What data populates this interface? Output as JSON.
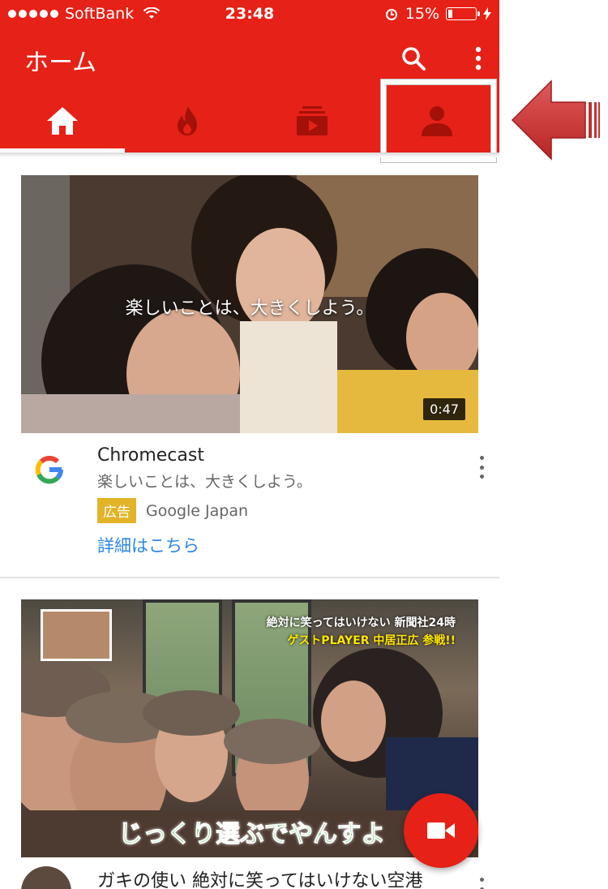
{
  "status_bar": {
    "carrier": "SoftBank",
    "time": "23:48",
    "battery": "15%",
    "battery_level": 0.15
  },
  "app_bar": {
    "title": "ホーム",
    "icons": [
      "search-icon",
      "more-vert-icon"
    ]
  },
  "tabs": [
    {
      "name": "home",
      "icon": "home-icon",
      "selected": true
    },
    {
      "name": "trending",
      "icon": "flame-icon",
      "selected": false
    },
    {
      "name": "subscriptions",
      "icon": "subscriptions-icon",
      "selected": false
    },
    {
      "name": "account",
      "icon": "account-icon",
      "selected": false,
      "highlighted": true
    }
  ],
  "videos": [
    {
      "thumbnail_caption": "楽しいことは、大きくしよう。",
      "duration": "0:47",
      "title": "Chromecast",
      "subtitle": "楽しいことは、大きくしよう。",
      "ad_badge": "広告",
      "channel": "Google Japan",
      "link": "詳細はこちら"
    },
    {
      "thumbnail_text_top": "絶対に笑ってはいけない 新聞社24時",
      "thumbnail_text_sub": "ゲストPLAYER 中居正広 参戦!!",
      "thumbnail_text_bottom": "じっくり選ぶでやんすよ",
      "title": "ガキの使い 絶対に笑ってはいけない空港"
    }
  ],
  "colors": {
    "brand_red": "#e62117",
    "ad_badge": "#e3b328",
    "link_blue": "#2d87e2",
    "arrow_red": "#d23a3a"
  }
}
